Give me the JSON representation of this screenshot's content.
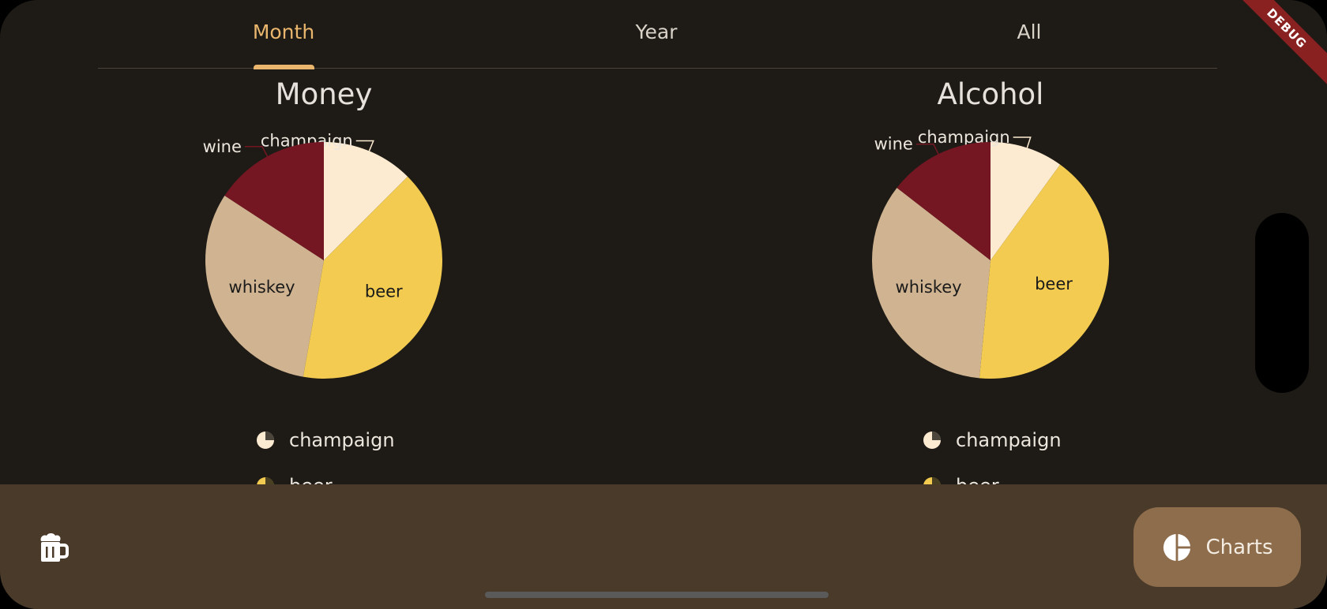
{
  "tabs": [
    {
      "label": "Month",
      "active": true
    },
    {
      "label": "Year",
      "active": false
    },
    {
      "label": "All",
      "active": false
    }
  ],
  "debug_banner": "DEBUG",
  "colors": {
    "champaign": "#fdebd1",
    "beer": "#f2cb50",
    "whiskey": "#d0b491",
    "wine": "#741722",
    "background": "#1e1b17",
    "accent": "#eab66d",
    "bottom_bar": "#4a3a29",
    "fab": "#8e6d4c"
  },
  "chart_data": [
    {
      "type": "pie",
      "title": "Money",
      "labels": [
        "champaign",
        "beer",
        "whiskey",
        "wine"
      ],
      "values": [
        12.5,
        40.3,
        31.4,
        15.8
      ]
    },
    {
      "type": "pie",
      "title": "Alcohol",
      "labels": [
        "champaign",
        "beer",
        "whiskey",
        "wine"
      ],
      "values": [
        10.0,
        41.5,
        34.0,
        14.5
      ]
    }
  ],
  "legend": [
    "champaign",
    "beer"
  ],
  "bottom_bar": {
    "beer_icon": "beer-mug-icon",
    "fab_icon": "pie-chart-icon",
    "fab_label": "Charts"
  }
}
